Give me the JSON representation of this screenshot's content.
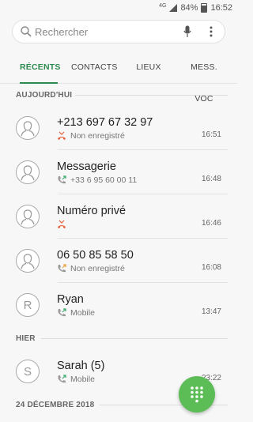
{
  "status": {
    "network": "4G",
    "battery": "84%",
    "time": "16:52"
  },
  "search": {
    "placeholder": "Rechercher"
  },
  "tabs": [
    {
      "label": "RÉCENTS",
      "active": true
    },
    {
      "label": "CONTACTS",
      "active": false
    },
    {
      "label": "LIEUX",
      "active": false
    },
    {
      "label": "MESS. VOC",
      "active": false
    }
  ],
  "sections": [
    {
      "title": "AUJOURD'HUI"
    },
    {
      "title": "HIER"
    },
    {
      "title": "24 DÉCEMBRE 2018"
    }
  ],
  "calls": [
    {
      "name": "+213 697 67 32 97",
      "detail": "Non enregistré",
      "time": "16:51",
      "type": "missed",
      "avatar": "person-icon"
    },
    {
      "name": "Messagerie",
      "detail": "+33 6 95 60 00 11",
      "time": "16:48",
      "type": "outgoing",
      "avatar": "person-icon"
    },
    {
      "name": "Numéro privé",
      "detail": "",
      "time": "16:46",
      "type": "missed",
      "avatar": "person-icon"
    },
    {
      "name": "06 50 85 58 50",
      "detail": "Non enregistré",
      "time": "16:08",
      "type": "outgoing",
      "avatar": "person-icon"
    },
    {
      "name": "Ryan",
      "detail": "Mobile",
      "time": "13:47",
      "type": "outgoing",
      "avatar": "R"
    },
    {
      "name": "Sarah (5)",
      "detail": "Mobile",
      "time": "23:22",
      "type": "outgoing",
      "avatar": "S"
    }
  ],
  "colors": {
    "accent": "#2d8a4f",
    "fab": "#5cbd57",
    "missed": "#e5603a",
    "outgoing": "#3aa86a"
  }
}
